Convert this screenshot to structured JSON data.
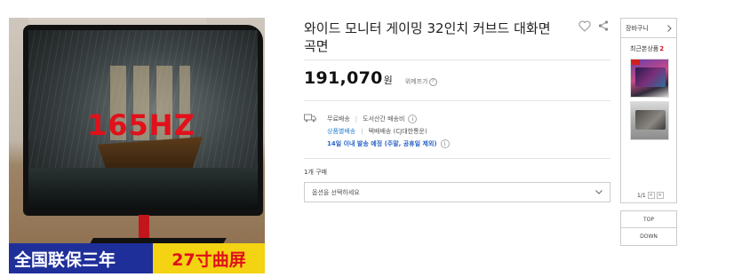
{
  "product": {
    "image_alt": "27inch curved gaming monitor",
    "screen_text": "165HZ",
    "banner_left": "全国联保三年",
    "banner_right": "27寸曲屏"
  },
  "title": "와이드 모니터 게이밍 32인치 커브드 대화면 곡면",
  "price": {
    "value": "191,070",
    "unit": "원",
    "unit_price_label": "위메프가",
    "help_glyph": "?"
  },
  "shipping": {
    "free_label": "무료배송",
    "remote_label": "도서산간 배송비",
    "info_glyph": "i",
    "option_link": "상품별배송",
    "courier": "택배배송 (CJ대한통운)",
    "eta": "14일 이내 발송 예정 (주말, 공휴일 제외)"
  },
  "purchase": {
    "label": "1개 구매",
    "option_placeholder": "옵션을 선택하세요"
  },
  "sidebar": {
    "cart_label": "장바구니",
    "recent_label": "최근본상품",
    "recent_count": "2",
    "page_indicator": "1/1",
    "prev_glyph": "<",
    "next_glyph": ">",
    "top_label": "TOP",
    "down_label": "DOWN"
  },
  "colors": {
    "accent_blue": "#2b7fd4",
    "banner_blue": "#1f2f9a",
    "banner_yellow": "#f3d312",
    "alert_red": "#e0101b"
  },
  "icons": [
    "heart-icon",
    "share-icon",
    "truck-icon",
    "chevron-down-icon",
    "chevron-right-icon"
  ]
}
